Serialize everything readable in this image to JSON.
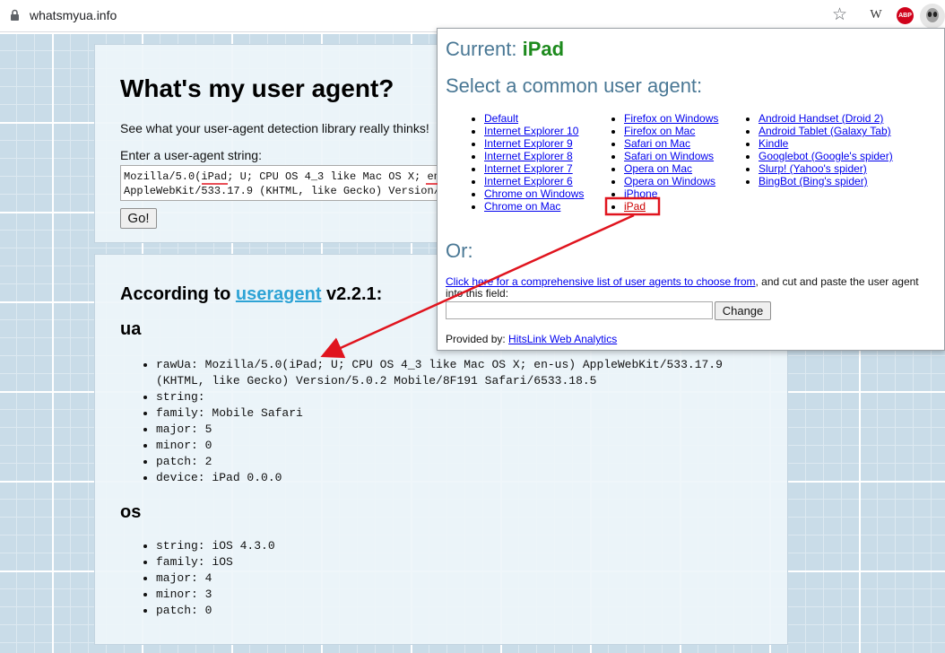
{
  "browser": {
    "url": "whatsmyua.info",
    "extension_w": "W",
    "extension_abp": "ABP"
  },
  "page": {
    "title": "What's my user agent?",
    "intro": "See what your user-agent detection library really thinks!",
    "enter_label": "Enter a user-agent string:",
    "ua_value": "Mozilla/5.0(iPad; U; CPU OS 4_3 like Mac OS X; en-us) AppleWebKit/533.17.9 (KHTML, like Gecko) Version/5.0.2 Mobile/8F191 Safari/6533.18.5",
    "go_label": "Go!",
    "according_prefix": "According to ",
    "library_link": "useragent",
    "version_suffix": " v2.2.1:",
    "ua_heading": "ua",
    "os_heading": "os",
    "ua_items": [
      "rawUa: Mozilla/5.0(iPad; U; CPU OS 4_3 like Mac OS X; en-us) AppleWebKit/533.17.9 (KHTML, like Gecko) Version/5.0.2 Mobile/8F191 Safari/6533.18.5",
      "string:",
      "family: Mobile Safari",
      "major: 5",
      "minor: 0",
      "patch: 2",
      "device: iPad 0.0.0"
    ],
    "os_items": [
      "string: iOS 4.3.0",
      "family: iOS",
      "major: 4",
      "minor: 3",
      "patch: 0"
    ]
  },
  "popup": {
    "current_label": "Current: ",
    "current_value": "iPad",
    "select_title": "Select a common user agent:",
    "col1": [
      "Default",
      "Internet Explorer 10",
      "Internet Explorer 9",
      "Internet Explorer 8",
      "Internet Explorer 7",
      "Internet Explorer 6",
      "Chrome on Windows",
      "Chrome on Mac"
    ],
    "col2": [
      "Firefox on Windows",
      "Firefox on Mac",
      "Safari on Mac",
      "Safari on Windows",
      "Opera on Mac",
      "Opera on Windows",
      "iPhone",
      "iPad"
    ],
    "col3": [
      "Android Handset (Droid 2)",
      "Android Tablet (Galaxy Tab)",
      "Kindle",
      "Googlebot (Google's spider)",
      "Slurp! (Yahoo's spider)",
      "BingBot (Bing's spider)"
    ],
    "or_label": "Or:",
    "list_link": "Click here for a comprehensive list of user agents to choose from",
    "list_suffix": ", and cut and paste the user agent into this field:",
    "change_label": "Change",
    "provided_label": "Provided by: ",
    "provided_link": "HitsLink Web Analytics"
  },
  "colors": {
    "annotation": "#e0141e",
    "current_value": "#1d8a1d",
    "heading": "#4a7895",
    "link": "#0000ee",
    "library_link": "#2ea3d5"
  }
}
